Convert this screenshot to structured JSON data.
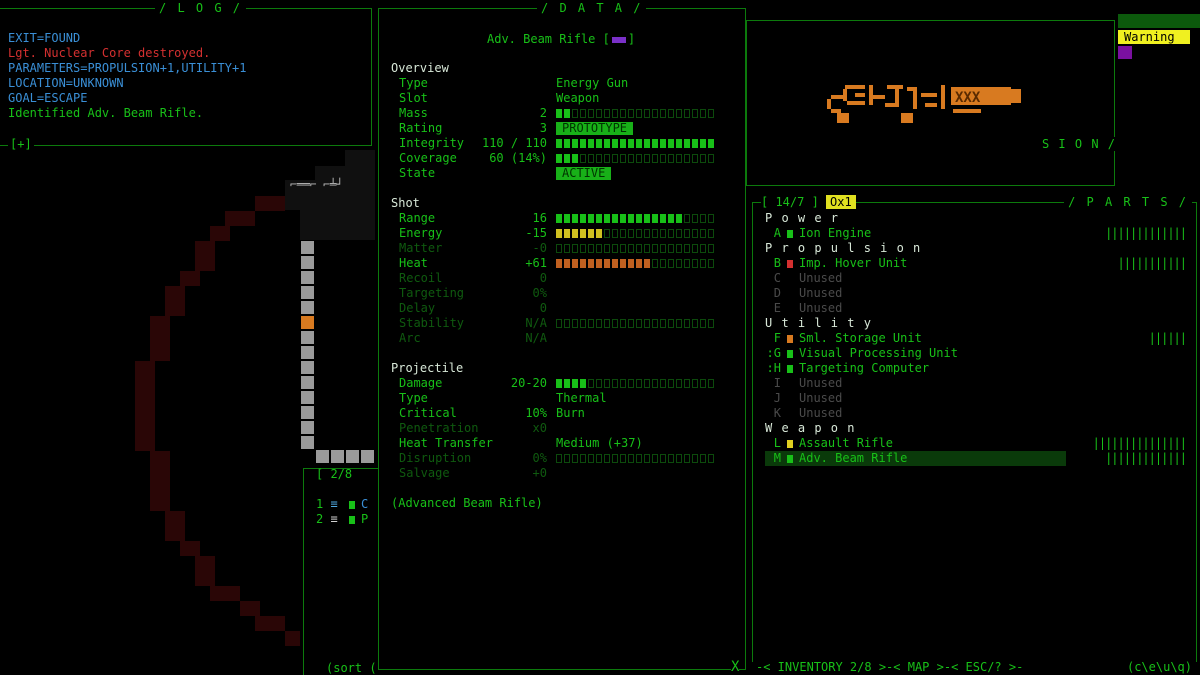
{
  "log": {
    "title": "/ L O G /",
    "corner": "[+]",
    "lines": [
      {
        "text": "EXIT=FOUND",
        "color": "blue"
      },
      {
        "text": "Lgt. Nuclear Core destroyed.",
        "color": "red"
      },
      {
        "text": "PARAMETERS=PROPULSION+1,UTILITY+1",
        "color": "blue"
      },
      {
        "text": "LOCATION=UNKNOWN",
        "color": "blue"
      },
      {
        "text": "GOAL=ESCAPE",
        "color": "blue"
      },
      {
        "text": "Identified Adv. Beam Rifle.",
        "color": "green"
      }
    ]
  },
  "data_panel": {
    "title": "/ D A T A /",
    "item_title": "Adv. Beam Rifle [",
    "item_title_end": "]",
    "close": "X",
    "overview_label": "Overview",
    "overview": [
      {
        "label": "Type",
        "value": "",
        "text": "Energy Gun"
      },
      {
        "label": "Slot",
        "value": "",
        "text": "Weapon"
      },
      {
        "label": "Mass",
        "value": "2",
        "bar": 2
      },
      {
        "label": "Rating",
        "value": "3",
        "tag": "PROTOTYPE"
      },
      {
        "label": "Integrity",
        "value": "110 / 110",
        "bar": 20
      },
      {
        "label": "Coverage",
        "value": "60 (14%)",
        "bar": 3
      },
      {
        "label": "State",
        "value": "",
        "tag": "ACTIVE"
      }
    ],
    "shot_label": "Shot",
    "shot": [
      {
        "label": "Range",
        "value": "16",
        "bar": 16,
        "color": "green"
      },
      {
        "label": "Energy",
        "value": "-15",
        "bar": 6,
        "color": "yellow"
      },
      {
        "label": "Matter",
        "value": "-0",
        "bar": 0,
        "dim": true
      },
      {
        "label": "Heat",
        "value": "+61",
        "bar": 12,
        "color": "orange"
      },
      {
        "label": "Recoil",
        "value": "0",
        "dim": true
      },
      {
        "label": "Targeting",
        "value": "0%",
        "dim": true
      },
      {
        "label": "Delay",
        "value": "0",
        "dim": true
      },
      {
        "label": "Stability",
        "value": "N/A",
        "bar": 0,
        "dim": true
      },
      {
        "label": "Arc",
        "value": "N/A",
        "dim": true
      }
    ],
    "projectile_label": "Projectile",
    "projectile": [
      {
        "label": "Damage",
        "value": "20-20",
        "bar": 4
      },
      {
        "label": "Type",
        "value": "",
        "text": "Thermal"
      },
      {
        "label": "Critical",
        "value": "10%",
        "text": "Burn"
      },
      {
        "label": "Penetration",
        "value": "x0",
        "dim": true
      },
      {
        "label": "Heat Transfer",
        "value": "",
        "text": "Medium (+37)"
      },
      {
        "label": "Disruption",
        "value": "0%",
        "bar": 0,
        "dim": true
      },
      {
        "label": "Salvage",
        "value": "+0",
        "dim": true
      }
    ],
    "description": "(Advanced Beam Rifle)"
  },
  "top_right": {
    "warning": "Warning",
    "vision_label": "S I O N /"
  },
  "parts": {
    "title": "/ P A R T S /",
    "slots": "[ 14/7 ]",
    "ox": "Ox1",
    "sections": [
      {
        "name": "P o w e r",
        "items": [
          {
            "key": "A",
            "name": "Ion Engine",
            "color": "#18c018",
            "health": "|||||||||||||",
            "active": true
          }
        ]
      },
      {
        "name": "P r o p u l s i o n",
        "items": [
          {
            "key": "B",
            "name": "Imp. Hover Unit",
            "color": "#d43030",
            "health": "|||||||||||",
            "active": true
          },
          {
            "key": "C",
            "name": "Unused",
            "color": "",
            "health": "",
            "active": false
          },
          {
            "key": "D",
            "name": "Unused",
            "color": "",
            "health": "",
            "active": false
          },
          {
            "key": "E",
            "name": "Unused",
            "color": "",
            "health": "",
            "active": false
          }
        ]
      },
      {
        "name": "U t i l i t y",
        "items": [
          {
            "key": "F",
            "name": "Sml. Storage Unit",
            "color": "#d87a20",
            "health": "||||||",
            "active": true
          },
          {
            "key": ":G",
            "name": "Visual Processing Unit",
            "color": "#18c018",
            "health": "",
            "active": true
          },
          {
            "key": ":H",
            "name": "Targeting Computer",
            "color": "#18c018",
            "health": "",
            "active": true
          },
          {
            "key": "I",
            "name": "Unused",
            "color": "",
            "health": "",
            "active": false
          },
          {
            "key": "J",
            "name": "Unused",
            "color": "",
            "health": "",
            "active": false
          },
          {
            "key": "K",
            "name": "Unused",
            "color": "",
            "health": "",
            "active": false
          }
        ]
      },
      {
        "name": "W e a p o n",
        "items": [
          {
            "key": "L",
            "name": "Assault Rifle",
            "color": "#e0d020",
            "health": "|||||||||||||||",
            "active": true
          },
          {
            "key": "M",
            "name": "Adv. Beam Rifle",
            "color": "#18c018",
            "health": "|||||||||||||",
            "active": true,
            "selected": true
          }
        ]
      }
    ]
  },
  "inventory": {
    "count": "[ 2/8",
    "items": [
      {
        "num": "1",
        "letter": "C"
      },
      {
        "num": "2",
        "letter": "P"
      }
    ],
    "sort": "(sort ("
  },
  "bottom_bar": {
    "text": "-< INVENTORY  2/8 >-< MAP >-< ESC/? >-",
    "right": "(c\\e\\u\\q)"
  }
}
